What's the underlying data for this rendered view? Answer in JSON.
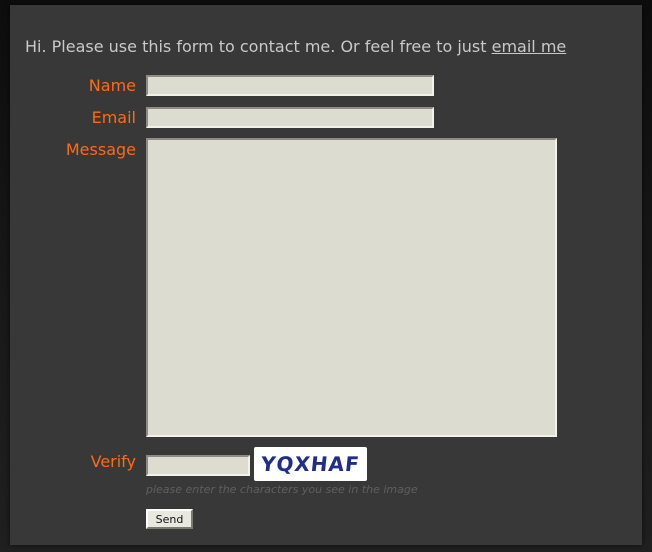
{
  "intro": {
    "text": "Hi. Please use this form to contact me. Or feel free to just ",
    "link": "email me"
  },
  "form": {
    "name_label": "Name",
    "email_label": "Email",
    "message_label": "Message",
    "verify_label": "Verify",
    "name_value": "",
    "email_value": "",
    "message_value": "",
    "verify_value": "",
    "captcha_text": "YQXHAF",
    "hint": "please enter the characters you see in the image",
    "send_label": "Send"
  },
  "colors": {
    "label": "#ff6a14",
    "panel": "#383838",
    "field": "#dcddd0",
    "captcha_text": "#1f2d8f"
  }
}
